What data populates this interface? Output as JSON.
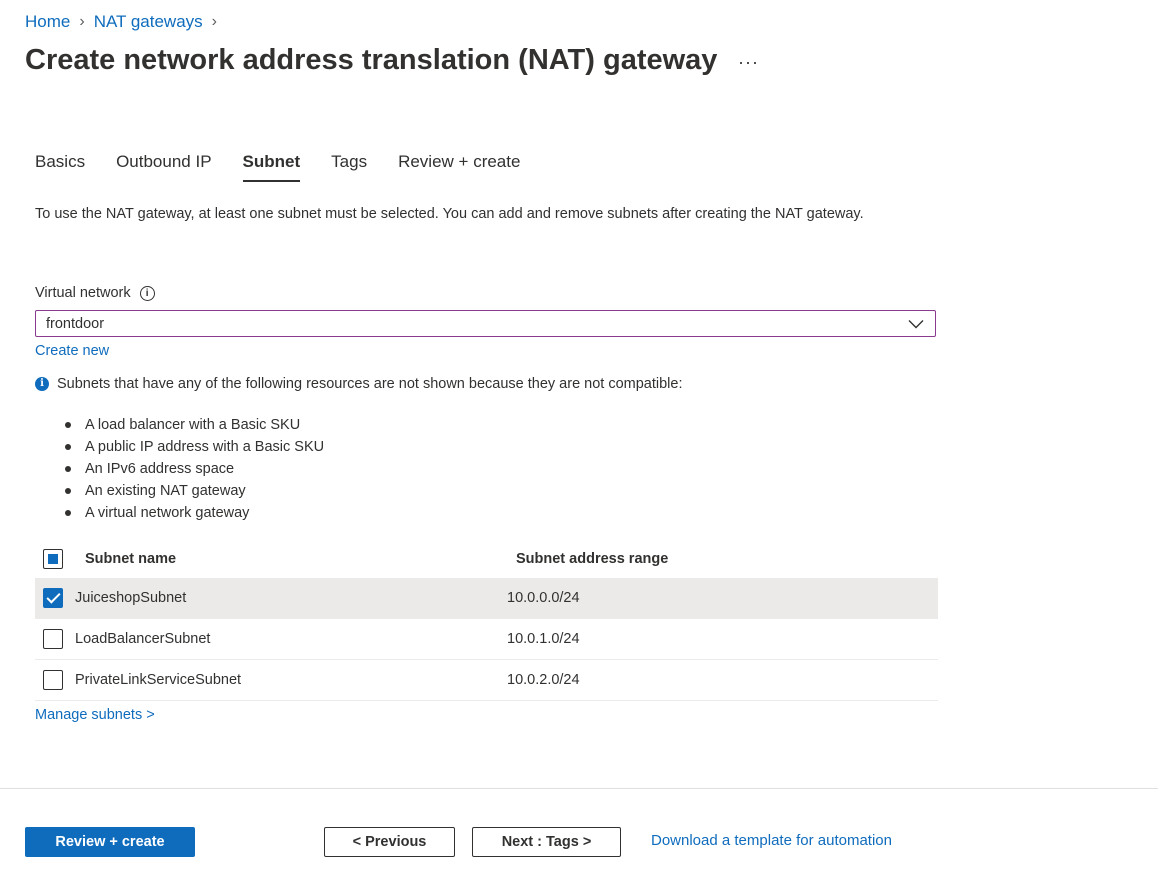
{
  "breadcrumb": {
    "home": "Home",
    "nat": "NAT gateways"
  },
  "page": {
    "title": "Create network address translation (NAT) gateway",
    "more": "···"
  },
  "tabs": [
    "Basics",
    "Outbound IP",
    "Subnet",
    "Tags",
    "Review + create"
  ],
  "active_tab": "Subnet",
  "description": "To use the NAT gateway, at least one subnet must be selected. You can add and remove subnets after creating the NAT gateway.",
  "virtual_network": {
    "label": "Virtual network",
    "value": "frontdoor",
    "create_new": "Create new"
  },
  "notice": {
    "text": "Subnets that have any of the following resources are not shown because they are not compatible:",
    "items": [
      "A load balancer with a Basic SKU",
      "A public IP address with a Basic SKU",
      "An IPv6 address space",
      "An existing NAT gateway",
      "A virtual network gateway"
    ]
  },
  "subnets": {
    "headers": {
      "name": "Subnet name",
      "range": "Subnet address range"
    },
    "rows": [
      {
        "name": "JuiceshopSubnet",
        "range": "10.0.0.0/24",
        "checked": true
      },
      {
        "name": "LoadBalancerSubnet",
        "range": "10.0.1.0/24",
        "checked": false
      },
      {
        "name": "PrivateLinkServiceSubnet",
        "range": "10.0.2.0/24",
        "checked": false
      }
    ],
    "manage": "Manage subnets >"
  },
  "footer": {
    "review_create": "Review + create",
    "previous": "< Previous",
    "next": "Next : Tags >",
    "download": "Download a template for automation"
  },
  "colors": {
    "accent": "#0f6cbd",
    "dropdown_border": "#8a3a8f",
    "selected_row": "#ebeae9"
  }
}
